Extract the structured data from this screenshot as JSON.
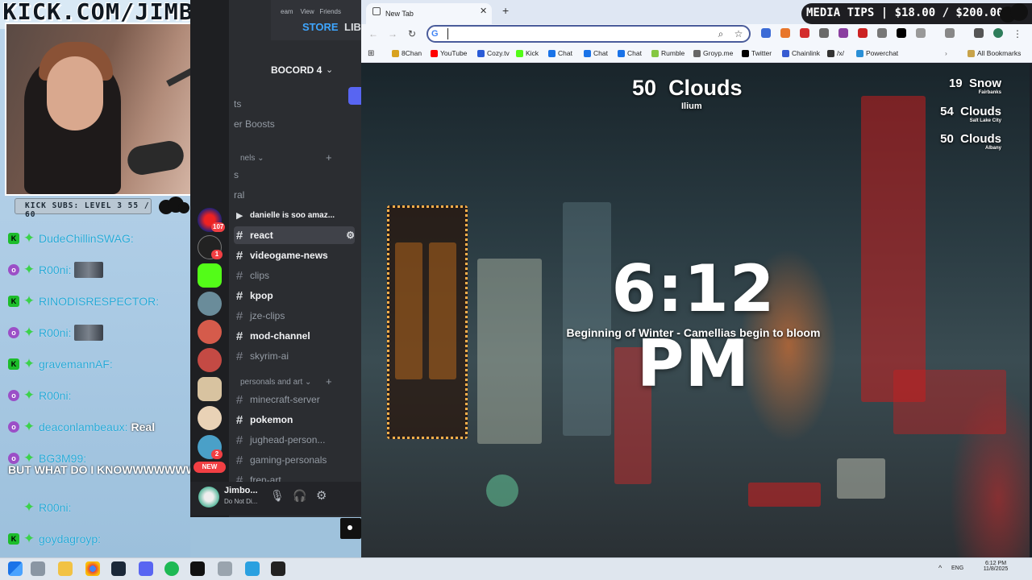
{
  "stream": {
    "site_banner": "KICK.COM/JIMBOZ",
    "sub_bar": "KICK SUBS: LEVEL 3 55 / 60",
    "media_tips": "MEDIA TIPS | $18.00 / $200.00"
  },
  "chat": [
    {
      "user": "DudeChillinSWAG:",
      "badge": "K",
      "msg": ""
    },
    {
      "user": "R00ni:",
      "badge": "o",
      "msg": ""
    },
    {
      "user": "RINODISRESPECTOR:",
      "badge": "K",
      "msg": ""
    },
    {
      "user": "R00ni:",
      "badge": "o",
      "msg": ""
    },
    {
      "user": "gravemannAF:",
      "badge": "K",
      "msg": ""
    },
    {
      "user": "R00ni:",
      "badge": "o",
      "msg": ""
    },
    {
      "user": "deaconlambeaux:",
      "badge": "o",
      "msg": "Real"
    },
    {
      "user": "BG3M99:",
      "badge": "o",
      "msg": "BUT WHAT DO I KNOWWWWWWWWWW"
    },
    {
      "user": "R00ni:",
      "badge": "",
      "msg": ""
    },
    {
      "user": "goydagroyp:",
      "badge": "K",
      "msg": ""
    }
  ],
  "discord": {
    "tabs": [
      "STORE",
      "LIBI"
    ],
    "server_name": "BOCORD 4",
    "partial_items": [
      "ts",
      "er Boosts",
      "nels",
      "s",
      "ral"
    ],
    "servers_badges": [
      "107",
      "1",
      "2"
    ],
    "new_label": "NEW",
    "channels": [
      {
        "name": "danielle is soo amaz...",
        "bold": true
      },
      {
        "name": "react",
        "bold": true
      },
      {
        "name": "videogame-news",
        "bold": true
      },
      {
        "name": "clips",
        "bold": false
      },
      {
        "name": "kpop",
        "bold": true
      },
      {
        "name": "jze-clips",
        "bold": false
      },
      {
        "name": "mod-channel",
        "bold": true
      },
      {
        "name": "skyrim-ai",
        "bold": false
      }
    ],
    "category2": "personals and art",
    "channels2": [
      {
        "name": "minecraft-server",
        "bold": false
      },
      {
        "name": "pokemon",
        "bold": true
      },
      {
        "name": "jughead-person...",
        "bold": false
      },
      {
        "name": "gaming-personals",
        "bold": false
      },
      {
        "name": "fren-art",
        "bold": false
      }
    ],
    "user": {
      "name": "Jimbo...",
      "status": "Do Not Di..."
    }
  },
  "browser": {
    "tab_title": "New Tab",
    "omnibox_value": "",
    "bookmarks": [
      "8Chan",
      "YouTube",
      "Cozy.tv",
      "Kick",
      "Chat",
      "Chat",
      "Chat",
      "Rumble",
      "Groyp.me",
      "Twitter",
      "Chainlink",
      "/x/",
      "Powerchat"
    ],
    "all_bookmarks": "All Bookmarks"
  },
  "newtab": {
    "time": "6:12 PM",
    "season": "Beginning of Winter - Camellias begin to bloom",
    "main_weather": {
      "temp": "50",
      "cond": "Clouds",
      "city": "Ilium"
    },
    "forecasts": [
      {
        "temp": "19",
        "cond": "Snow",
        "city": "Fairbanks"
      },
      {
        "temp": "54",
        "cond": "Clouds",
        "city": "Salt Lake City"
      },
      {
        "temp": "50",
        "cond": "Clouds",
        "city": "Albany"
      }
    ]
  },
  "taskbar": {
    "lang": "ENG",
    "time": "6:12 PM",
    "date": "11/8/2025"
  },
  "colors": {
    "kick_green": "#1dbd2b",
    "discord_bg": "#2b2d31",
    "accent_blue": "#4a5c9b"
  }
}
